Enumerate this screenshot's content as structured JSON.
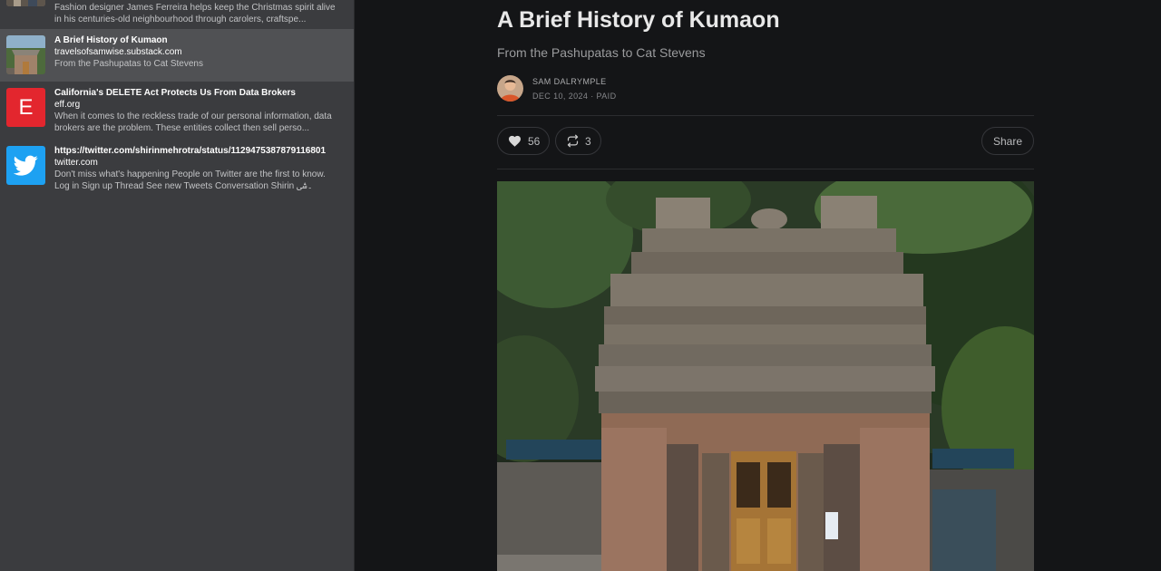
{
  "sidebar": {
    "items": [
      {
        "excerpt": "Fashion designer James Ferreira helps keep the Christmas spirit alive in his centuries-old neighbourhood through carolers, craftspe..."
      },
      {
        "title": "A Brief History of Kumaon",
        "domain": "travelsofsamwise.substack.com",
        "excerpt": "From the Pashupatas to Cat Stevens"
      },
      {
        "title": "California's DELETE Act Protects Us From Data Brokers",
        "domain": "eff.org",
        "excerpt": "When it comes to the reckless trade of our personal information, data brokers are the problem. These entities collect then sell perso...",
        "icon_letter": "E",
        "icon_color": "#e3262e"
      },
      {
        "title": "https://twitter.com/shirinmehrotra/status/1129475387879116801",
        "domain": "twitter.com",
        "excerpt": "Don't miss what's happening People on Twitter are the first to know. Log in Sign up Thread See new Tweets Conversation Shirin ۔شی",
        "icon": "twitter-bird-icon",
        "icon_color": "#1da1f2"
      }
    ]
  },
  "article": {
    "title": "A Brief History of Kumaon",
    "subtitle": "From the Pashupatas to Cat Stevens",
    "author": "SAM DALRYMPLE",
    "meta": "DEC 10, 2024 · PAID",
    "likes": "56",
    "restacks": "3",
    "share_label": "Share"
  }
}
